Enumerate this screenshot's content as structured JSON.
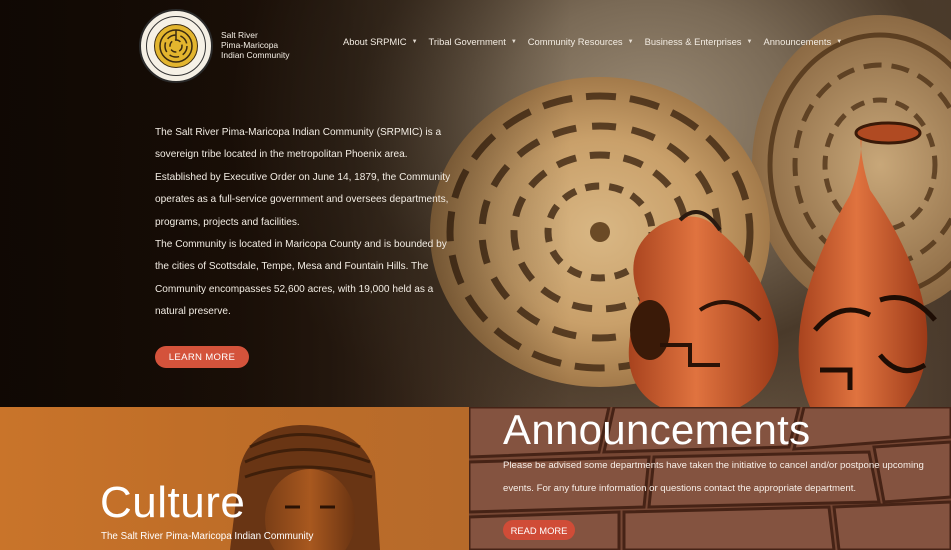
{
  "header": {
    "brand_lines": [
      "Salt River",
      "Pima-Maricopa",
      "Indian Community"
    ],
    "nav": [
      {
        "label": "About SRPMIC"
      },
      {
        "label": "Tribal Government"
      },
      {
        "label": "Community Resources"
      },
      {
        "label": "Business & Enterprises"
      },
      {
        "label": "Announcements"
      }
    ],
    "icons": {
      "logo": "community-seal-icon",
      "caret": "chevron-down-icon"
    }
  },
  "hero": {
    "paragraphs": [
      "The Salt River Pima-Maricopa Indian Community (SRPMIC) is a sovereign tribe located in the metropolitan Phoenix area. Established by Executive Order on June 14, 1879, the Community operates as a full-service government and oversees departments, programs, projects and facilities.",
      "The Community is located in Maricopa County and is bounded by the cities of Scottsdale, Tempe, Mesa and Fountain Hills. The Community encompasses 52,600 acres, with 19,000 held as a natural preserve."
    ],
    "button_label": "LEARN MORE"
  },
  "culture": {
    "title": "Culture",
    "subtitle": "The Salt River Pima-Maricopa Indian Community"
  },
  "announcements": {
    "title": "Announcements",
    "text": "Please be advised some departments have taken the initiative to cancel and/or postpone upcoming events. For any future information or questions contact the appropriate department.",
    "button_label": "READ MORE"
  },
  "colors": {
    "accent": "#d4533b",
    "culture_bg": "#c9742a",
    "announcements_bg": "#7a4a36",
    "seal_gold": "#e3b52e"
  }
}
